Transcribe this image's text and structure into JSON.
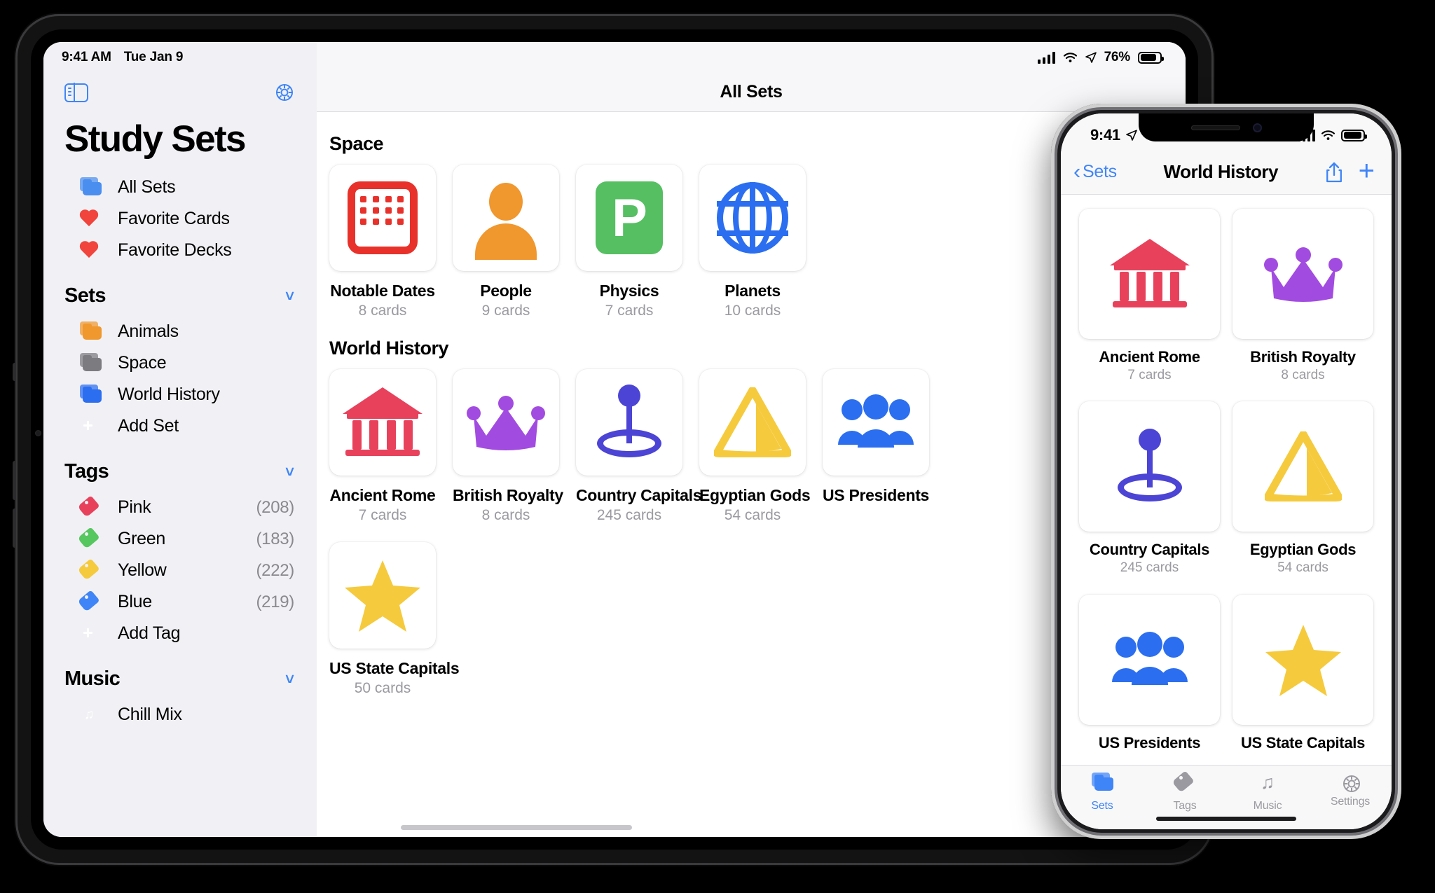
{
  "ipad": {
    "status": {
      "time": "9:41 AM",
      "date": "Tue Jan 9",
      "battery_pct": "76%"
    },
    "sidebar": {
      "toggle_icon": "sidebar-toggle-icon",
      "settings_icon": "gear-icon",
      "title": "Study Sets",
      "top_items": [
        {
          "label": "All Sets",
          "icon": "folder-icon",
          "color": "#4a8ef0"
        },
        {
          "label": "Favorite Cards",
          "icon": "heart-icon",
          "color": "#f0443c"
        },
        {
          "label": "Favorite Decks",
          "icon": "heart-icon",
          "color": "#f0443c"
        }
      ],
      "groups": [
        {
          "title": "Sets",
          "chevron": "chevron-down-icon",
          "items": [
            {
              "label": "Animals",
              "icon": "folder-icon",
              "color": "#f0972e",
              "count": ""
            },
            {
              "label": "Space",
              "icon": "folder-icon",
              "color": "#7b7b80",
              "count": ""
            },
            {
              "label": "World History",
              "icon": "folder-icon",
              "color": "#2b6ef0",
              "count": ""
            },
            {
              "label": "Add Set",
              "icon": "plus-square-icon",
              "color": "#4f9cf4",
              "count": ""
            }
          ]
        },
        {
          "title": "Tags",
          "chevron": "chevron-down-icon",
          "items": [
            {
              "label": "Pink",
              "icon": "tag-icon",
              "color": "#e8415c",
              "count": "(208)"
            },
            {
              "label": "Green",
              "icon": "tag-icon",
              "color": "#55c75e",
              "count": "(183)"
            },
            {
              "label": "Yellow",
              "icon": "tag-icon",
              "color": "#f5ca3c",
              "count": "(222)"
            },
            {
              "label": "Blue",
              "icon": "tag-icon",
              "color": "#3f85f7",
              "count": "(219)"
            },
            {
              "label": "Add Tag",
              "icon": "plus-square-icon",
              "color": "#4f9cf4",
              "count": ""
            }
          ]
        },
        {
          "title": "Music",
          "chevron": "chevron-down-icon",
          "items": [
            {
              "label": "Chill Mix",
              "icon": "music-note-icon",
              "color": "#f0443c",
              "count": ""
            }
          ]
        }
      ]
    },
    "detail": {
      "nav_title": "All Sets",
      "sections": [
        {
          "title": "Space",
          "cards": [
            {
              "name": "Notable Dates",
              "count": "8 cards",
              "glyph": "calendar-icon",
              "color": "#e8312a"
            },
            {
              "name": "People",
              "count": "9 cards",
              "glyph": "person-icon",
              "color": "#f0972e"
            },
            {
              "name": "Physics",
              "count": "7 cards",
              "glyph": "letter-p-icon",
              "color": "#55bf62"
            },
            {
              "name": "Planets",
              "count": "10 cards",
              "glyph": "globe-icon",
              "color": "#2b6ef0"
            }
          ]
        },
        {
          "title": "World History",
          "cards": [
            {
              "name": "Ancient Rome",
              "count": "7 cards",
              "glyph": "temple-icon",
              "color": "#e8415c"
            },
            {
              "name": "British Royalty",
              "count": "8 cards",
              "glyph": "crown-icon",
              "color": "#a24be0"
            },
            {
              "name": "Country Capitals",
              "count": "245 cards",
              "glyph": "map-pin-icon",
              "color": "#4b44d4"
            },
            {
              "name": "Egyptian Gods",
              "count": "54 cards",
              "glyph": "triangle-icon",
              "color": "#f5ca3c"
            },
            {
              "name": "US Presidents",
              "count": "",
              "glyph": "people-group-icon",
              "color": "#2b6ef0"
            }
          ]
        },
        {
          "title": "",
          "cards": [
            {
              "name": "US State Capitals",
              "count": "50 cards",
              "glyph": "star-icon",
              "color": "#f5ca3c"
            }
          ]
        }
      ]
    }
  },
  "iphone": {
    "status": {
      "time": "9:41"
    },
    "nav": {
      "back_label": "Sets",
      "title": "World History",
      "share_icon": "share-icon",
      "add_icon": "plus-icon"
    },
    "cards": [
      {
        "name": "Ancient Rome",
        "count": "7 cards",
        "glyph": "temple-icon",
        "color": "#e8415c"
      },
      {
        "name": "British Royalty",
        "count": "8 cards",
        "glyph": "crown-icon",
        "color": "#a24be0"
      },
      {
        "name": "Country Capitals",
        "count": "245 cards",
        "glyph": "map-pin-icon",
        "color": "#4b44d4"
      },
      {
        "name": "Egyptian Gods",
        "count": "54 cards",
        "glyph": "triangle-icon",
        "color": "#f5ca3c"
      },
      {
        "name": "US Presidents",
        "count": "",
        "glyph": "people-group-icon",
        "color": "#2b6ef0"
      },
      {
        "name": "US State Capitals",
        "count": "",
        "glyph": "star-icon",
        "color": "#f5ca3c"
      }
    ],
    "tabs": [
      {
        "label": "Sets",
        "icon": "folder-icon",
        "active": true
      },
      {
        "label": "Tags",
        "icon": "tag-icon",
        "active": false
      },
      {
        "label": "Music",
        "icon": "music-note-icon",
        "active": false
      },
      {
        "label": "Settings",
        "icon": "gear-icon",
        "active": false
      }
    ]
  }
}
